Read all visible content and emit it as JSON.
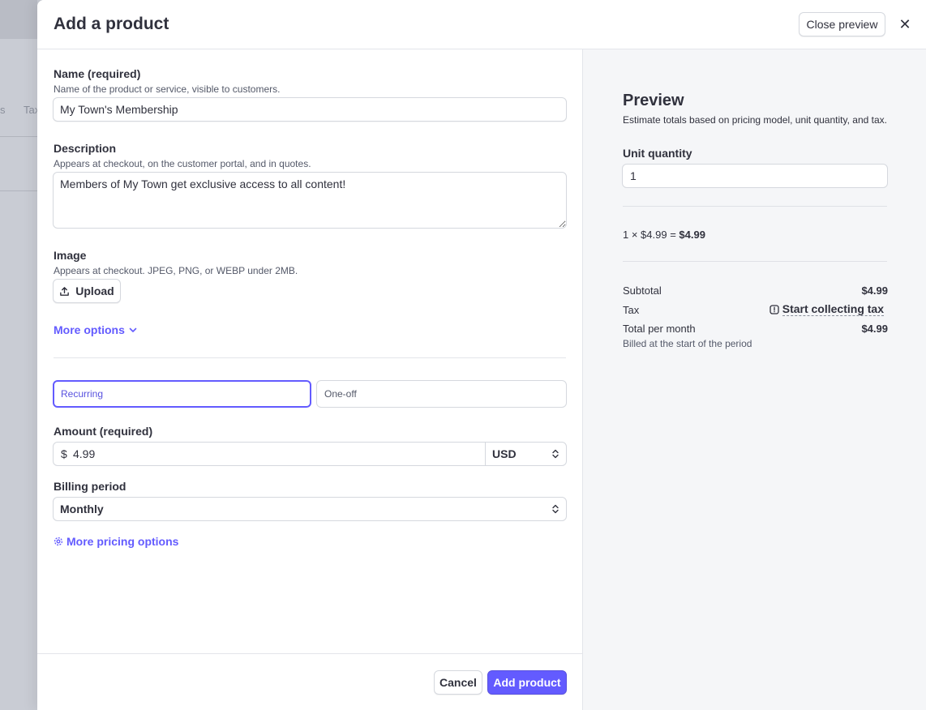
{
  "backdrop": {
    "tab_fragments": [
      "s",
      "Tax"
    ]
  },
  "header": {
    "title": "Add a product",
    "close_preview_label": "Close preview",
    "close_glyph": "✕"
  },
  "form": {
    "name": {
      "label": "Name (required)",
      "hint": "Name of the product or service, visible to customers.",
      "value": "My Town's Membership"
    },
    "description": {
      "label": "Description",
      "hint": "Appears at checkout, on the customer portal, and in quotes.",
      "value": "Members of My Town get exclusive access to all content!"
    },
    "image": {
      "label": "Image",
      "hint": "Appears at checkout. JPEG, PNG, or WEBP under 2MB.",
      "upload_label": "Upload"
    },
    "more_options_label": "More options",
    "pricing_type": {
      "options": [
        "Recurring",
        "One-off"
      ],
      "selected": "Recurring"
    },
    "amount": {
      "label": "Amount (required)",
      "prefix": "$",
      "value": "4.99",
      "currency": "USD"
    },
    "billing_period": {
      "label": "Billing period",
      "value": "Monthly"
    },
    "more_pricing_label": "More pricing options"
  },
  "footer": {
    "cancel_label": "Cancel",
    "add_label": "Add product"
  },
  "preview": {
    "title": "Preview",
    "subtitle": "Estimate totals based on pricing model, unit quantity, and tax.",
    "unit_quantity_label": "Unit quantity",
    "unit_quantity_value": "1",
    "calc_prefix": "1 × $4.99 =",
    "calc_total": "$4.99",
    "subtotal_label": "Subtotal",
    "subtotal_value": "$4.99",
    "tax_label": "Tax",
    "tax_link": "Start collecting tax",
    "total_label": "Total per month",
    "total_value": "$4.99",
    "billed_note": "Billed at the start of the period"
  },
  "colors": {
    "accent": "#635bff",
    "text": "#30313d",
    "border": "#d5d8de",
    "preview_bg": "#f5f6f8"
  }
}
